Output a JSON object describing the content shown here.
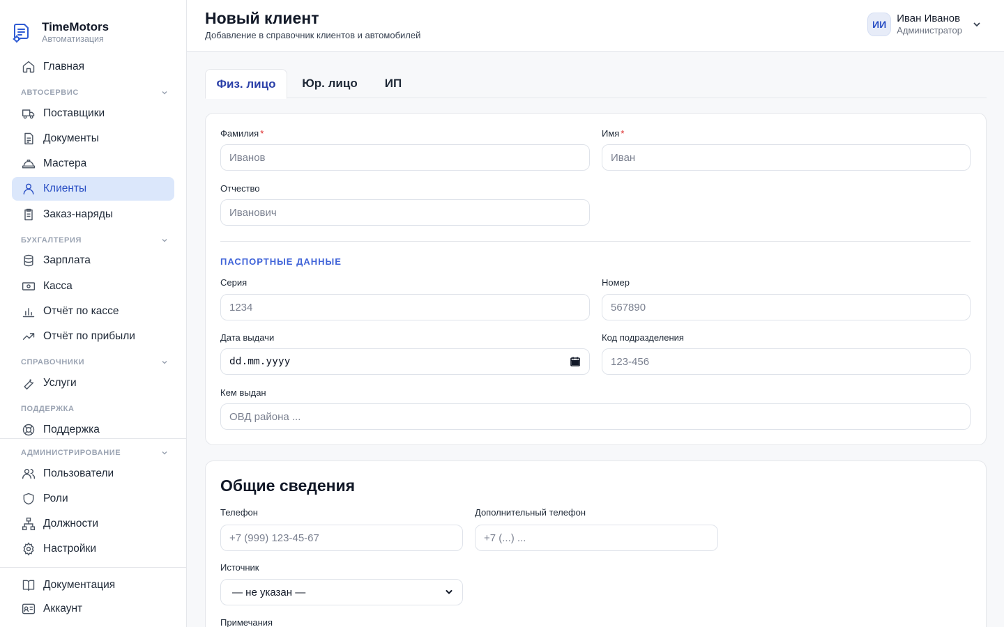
{
  "brand": {
    "name": "TimeMotors",
    "subtitle": "Автоматизация"
  },
  "sidebar": {
    "home": "Главная",
    "sections": {
      "autoservice": "АВТОСЕРВИС",
      "accounting": "БУХГАЛТЕРИЯ",
      "references": "СПРАВОЧНИКИ",
      "support": "ПОДДЕРЖКА",
      "admin": "АДМИНИСТРИРОВАНИЕ"
    },
    "items": {
      "suppliers": "Поставщики",
      "documents": "Документы",
      "masters": "Мастера",
      "clients": "Клиенты",
      "orders": "Заказ-наряды",
      "salary": "Зарплата",
      "cash": "Касса",
      "cash_report": "Отчёт по кассе",
      "profit_report": "Отчёт по прибыли",
      "services": "Услуги",
      "support": "Поддержка",
      "users": "Пользователи",
      "roles": "Роли",
      "positions": "Должности",
      "settings": "Настройки",
      "docs": "Документация",
      "account": "Аккаунт"
    },
    "active": "clients"
  },
  "header": {
    "title": "Новый клиент",
    "subtitle": "Добавление в справочник клиентов и автомобилей",
    "user": {
      "initials": "ИИ",
      "name": "Иван Иванов",
      "role": "Администратор"
    }
  },
  "tabs": [
    "Физ. лицо",
    "Юр. лицо",
    "ИП"
  ],
  "active_tab": 0,
  "person": {
    "last_name": {
      "label": "Фамилия",
      "required": "*",
      "placeholder": "Иванов"
    },
    "first_name": {
      "label": "Имя",
      "required": "*",
      "placeholder": "Иван"
    },
    "middle_name": {
      "label": "Отчество",
      "placeholder": "Иванович"
    },
    "passport_title": "ПАСПОРТНЫЕ ДАННЫЕ",
    "series": {
      "label": "Серия",
      "placeholder": "1234"
    },
    "number": {
      "label": "Номер",
      "placeholder": "567890"
    },
    "issue_date": {
      "label": "Дата выдачи",
      "value": "dd.mm.yyyy"
    },
    "division_code": {
      "label": "Код подразделения",
      "placeholder": "123-456"
    },
    "issued_by": {
      "label": "Кем выдан",
      "placeholder": "ОВД района ..."
    }
  },
  "general": {
    "title": "Общие сведения",
    "phone": {
      "label": "Телефон",
      "placeholder": "+7 (999) 123-45-67"
    },
    "extra_phone": {
      "label": "Дополнительный телефон",
      "placeholder": "+7 (...) ..."
    },
    "source": {
      "label": "Источник",
      "value": "— не указан —"
    },
    "notes": {
      "label": "Примечания"
    }
  },
  "colors": {
    "accent": "#2a4fc4",
    "active_bg": "#dbe7fb",
    "required": "#dc2626",
    "section": "#3f63d8"
  },
  "icons": {
    "brand": "document-gear-icon",
    "home": "home-icon",
    "suppliers": "truck-icon",
    "documents": "document-icon",
    "masters": "hard-hat-icon",
    "clients": "user-icon",
    "orders": "clipboard-icon",
    "salary": "database-icon",
    "cash": "banknote-icon",
    "cash_report": "bar-chart-icon",
    "profit_report": "trend-up-icon",
    "services": "wrench-icon",
    "support": "lifebuoy-icon",
    "users": "users-icon",
    "roles": "shield-icon",
    "positions": "org-chart-icon",
    "settings": "gear-icon",
    "docs": "book-icon",
    "account": "id-card-icon"
  }
}
